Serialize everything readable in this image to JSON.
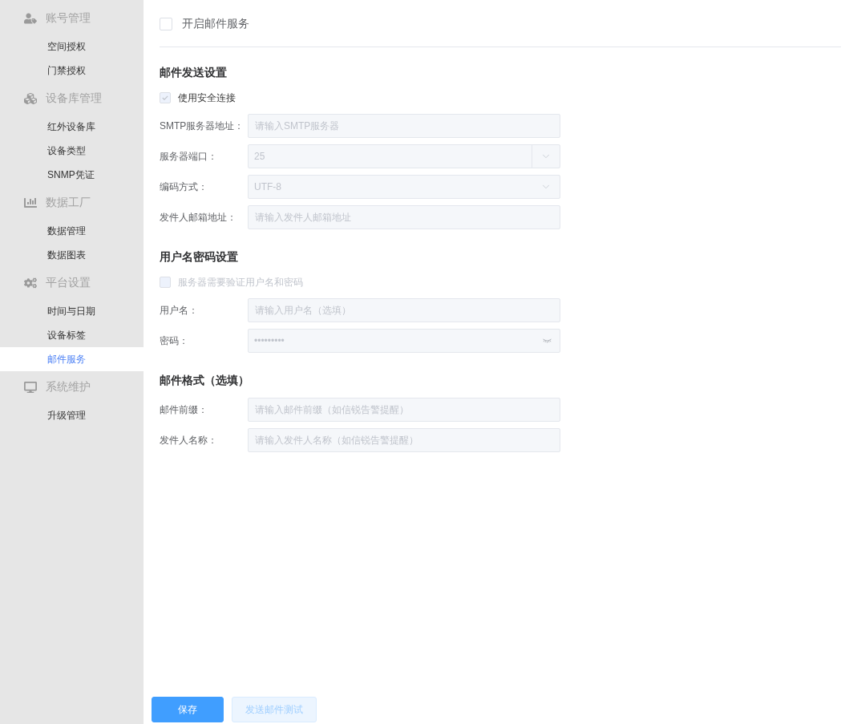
{
  "sidebar": {
    "groups": [
      {
        "label": "账号管理",
        "items": [
          {
            "label": "空间授权",
            "selected": false
          },
          {
            "label": "门禁授权",
            "selected": false
          }
        ]
      },
      {
        "label": "设备库管理",
        "items": [
          {
            "label": "红外设备库",
            "selected": false
          },
          {
            "label": "设备类型",
            "selected": false
          },
          {
            "label": "SNMP凭证",
            "selected": false
          }
        ]
      },
      {
        "label": "数据工厂",
        "items": [
          {
            "label": "数据管理",
            "selected": false
          },
          {
            "label": "数据图表",
            "selected": false
          }
        ]
      },
      {
        "label": "平台设置",
        "items": [
          {
            "label": "时间与日期",
            "selected": false
          },
          {
            "label": "设备标签",
            "selected": false
          },
          {
            "label": "邮件服务",
            "selected": true
          }
        ]
      },
      {
        "label": "系统维护",
        "items": [
          {
            "label": "升级管理",
            "selected": false
          }
        ]
      }
    ]
  },
  "enable_service": {
    "label": "开启邮件服务",
    "checked": false
  },
  "sections": [
    {
      "title": "邮件发送设置",
      "rows": [
        {
          "kind": "checkbox",
          "label": "使用安全连接",
          "checked": true,
          "disabled": true
        },
        {
          "kind": "input",
          "label": "SMTP服务器地址：",
          "placeholder": "请输入SMTP服务器",
          "disabled": true
        },
        {
          "kind": "combobox",
          "label": "服务器端口：",
          "value": "25",
          "disabled": true
        },
        {
          "kind": "select",
          "label": "编码方式：",
          "value": "UTF-8",
          "disabled": true
        },
        {
          "kind": "input",
          "label": "发件人邮箱地址：",
          "placeholder": "请输入发件人邮箱地址",
          "disabled": true
        }
      ]
    },
    {
      "title": "用户名密码设置",
      "rows": [
        {
          "kind": "checkbox",
          "label": "服务器需要验证用户名和密码",
          "checked": false,
          "disabled": true
        },
        {
          "kind": "input",
          "label": "用户名：",
          "placeholder": "请输入用户名（选填）",
          "disabled": true
        },
        {
          "kind": "password",
          "label": "密码：",
          "value": "•••••••••",
          "disabled": true
        }
      ]
    },
    {
      "title": "邮件格式（选填）",
      "rows": [
        {
          "kind": "input",
          "label": "邮件前缀：",
          "placeholder": "请输入邮件前缀（如信锐告警提醒）",
          "disabled": true
        },
        {
          "kind": "input",
          "label": "发件人名称：",
          "placeholder": "请输入发件人名称（如信锐告警提醒）",
          "disabled": true
        }
      ]
    }
  ],
  "buttons": [
    {
      "label": "保存",
      "kind": "primary",
      "disabled": false
    },
    {
      "label": "发送邮件测试",
      "kind": "plain",
      "disabled": true
    }
  ]
}
